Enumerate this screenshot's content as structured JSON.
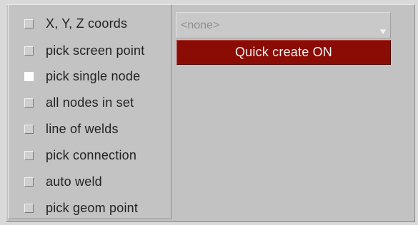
{
  "options": [
    {
      "label": "X, Y, Z coords",
      "checked": false
    },
    {
      "label": "pick screen point",
      "checked": false
    },
    {
      "label": "pick single node",
      "checked": true
    },
    {
      "label": "all nodes in set",
      "checked": false
    },
    {
      "label": "line of welds",
      "checked": false
    },
    {
      "label": "pick connection",
      "checked": false
    },
    {
      "label": "auto weld",
      "checked": false
    },
    {
      "label": "pick geom point",
      "checked": false
    }
  ],
  "dropdown": {
    "value": "<none>",
    "arrow_icon": "triangle-down-icon"
  },
  "quick_create": {
    "label": "Quick create ON",
    "color": "#8a0c05"
  }
}
